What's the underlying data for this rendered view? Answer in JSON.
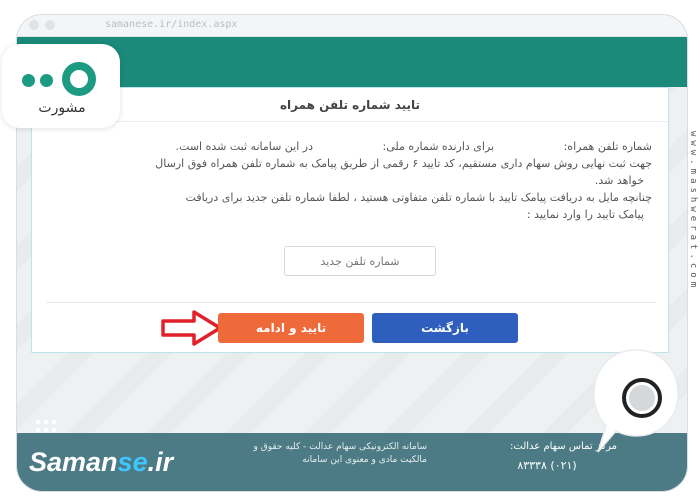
{
  "browser": {
    "url": "samanese.ir/index.aspx"
  },
  "dialog": {
    "title": "تایید شماره تلفن همراه",
    "line1_part1": "شماره تلفن همراه:",
    "line1_part2": "برای دارنده شماره ملی:",
    "line1_part3": "در این سامانه ثبت شده است.",
    "line2": "جهت ثبت نهایی روش سهام داری مستقیم، کد تایید ۶ رقمی از طریق پیامک به شماره تلفن همراه فوق ارسال",
    "line3": "خواهد شد.",
    "line4": "چنانچه مایل به دریافت پیامک تایید با شماره تلفن متفاوتی هستید ، لطفا شماره تلفن جدید برای دریافت",
    "line5": "پیامک تایید را وارد نمایید :",
    "phone_placeholder": "شماره تلفن جدید"
  },
  "buttons": {
    "confirm_label": "تایید و ادامه",
    "back_label": "بازگشت"
  },
  "footer": {
    "brand_part1": "Saman",
    "brand_part2": "se",
    "brand_part3": ".ir",
    "description": "سامانه الکترونیکی سهام عدالت - کلیه حقوق و مالکیت مادی و معنوی این سامانه",
    "contact_title": "مرکز تماس سهام عدالت:",
    "contact_phone": "(۰۲۱) ۸۳۳۳۸"
  },
  "overlays": {
    "logo_word": "مشورت",
    "side_url": "www.mashwerat.com"
  },
  "colors": {
    "teal_header": "#1b8a7a",
    "confirm_button": "#ee6a3b",
    "back_button": "#2e5fbf",
    "footer": "#4d7b85",
    "brand_accent": "#3ec6ff",
    "arrow": "#e0202a"
  }
}
